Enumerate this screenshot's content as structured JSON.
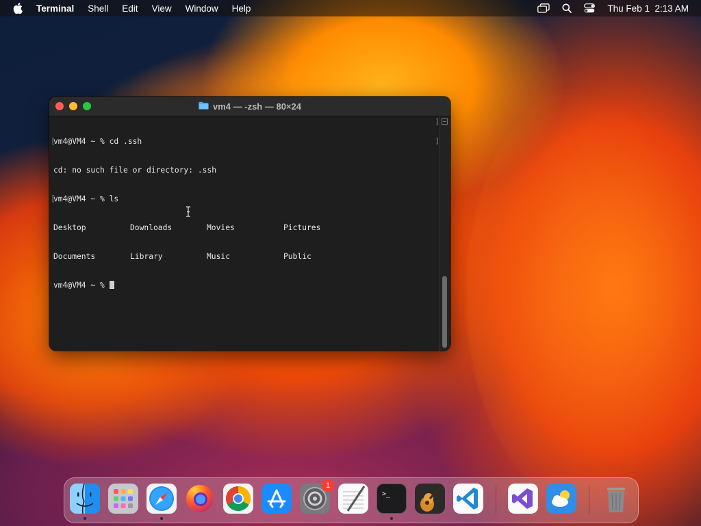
{
  "menubar": {
    "app_name": "Terminal",
    "items": [
      "Shell",
      "Edit",
      "View",
      "Window",
      "Help"
    ],
    "clock": "Thu Feb 1  2:13 AM",
    "status_icons": [
      "screen-mirroring-icon",
      "spotlight-search-icon",
      "control-center-icon"
    ]
  },
  "window": {
    "title": "vm4 — -zsh — 80×24",
    "folder_icon": "folder-icon"
  },
  "terminal": {
    "lines": [
      "vm4@VM4 ~ % cd .ssh",
      "cd: no such file or directory: .ssh",
      "vm4@VM4 ~ % ls"
    ],
    "ls_output": [
      [
        "Desktop",
        "Downloads",
        "Movies",
        "Pictures"
      ],
      [
        "Documents",
        "Library",
        "Music",
        "Public"
      ]
    ],
    "prompt": "vm4@VM4 ~ % "
  },
  "dock": {
    "apps": [
      {
        "name": "Finder",
        "icon": "finder-icon",
        "running": true
      },
      {
        "name": "Launchpad",
        "icon": "launchpad-icon",
        "running": false
      },
      {
        "name": "Safari",
        "icon": "safari-icon",
        "running": true
      },
      {
        "name": "Firefox",
        "icon": "firefox-icon",
        "running": false
      },
      {
        "name": "Google Chrome",
        "icon": "chrome-icon",
        "running": false
      },
      {
        "name": "App Store",
        "icon": "app-store-icon",
        "running": false
      },
      {
        "name": "System Settings",
        "icon": "system-settings-icon",
        "running": false,
        "badge": "1"
      },
      {
        "name": "TextEdit",
        "icon": "textedit-icon",
        "running": false
      },
      {
        "name": "Terminal",
        "icon": "terminal-icon",
        "running": true
      },
      {
        "name": "GarageBand",
        "icon": "garageband-icon",
        "running": false
      },
      {
        "name": "Visual Studio Code",
        "icon": "vscode-icon",
        "running": false
      },
      {
        "name": "Visual Studio",
        "icon": "visual-studio-icon",
        "running": false
      },
      {
        "name": "Weather",
        "icon": "weather-icon",
        "running": false
      },
      {
        "name": "Trash",
        "icon": "trash-icon",
        "running": false
      }
    ]
  },
  "colors": {
    "close": "#ff5f57",
    "minimize": "#febc2e",
    "maximize": "#28c840",
    "badge": "#ff3b30"
  }
}
